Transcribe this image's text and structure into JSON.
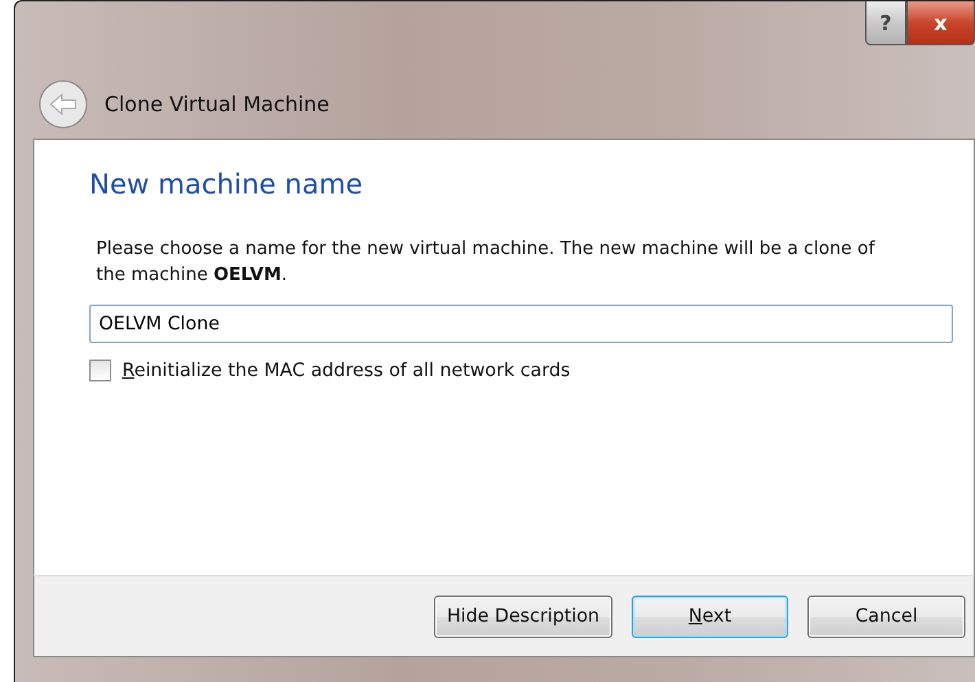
{
  "window": {
    "title": "Clone Virtual Machine",
    "help_button": "?",
    "close_button": "x"
  },
  "page": {
    "heading": "New machine name",
    "description": "Please choose a name for the new virtual machine. The new machine will be a clone of the machine **OELVM**.",
    "name_field": {
      "value": "OELVM Clone"
    },
    "options": [
      {
        "label": "Reinitialize the MAC address of all network cards",
        "checked": false,
        "accel": true
      }
    ]
  },
  "buttons": [
    {
      "label": "Hide Description",
      "default": false,
      "accel": false
    },
    {
      "label": "Next",
      "default": true,
      "accel": true
    },
    {
      "label": "Cancel",
      "default": false,
      "accel": false
    }
  ]
}
